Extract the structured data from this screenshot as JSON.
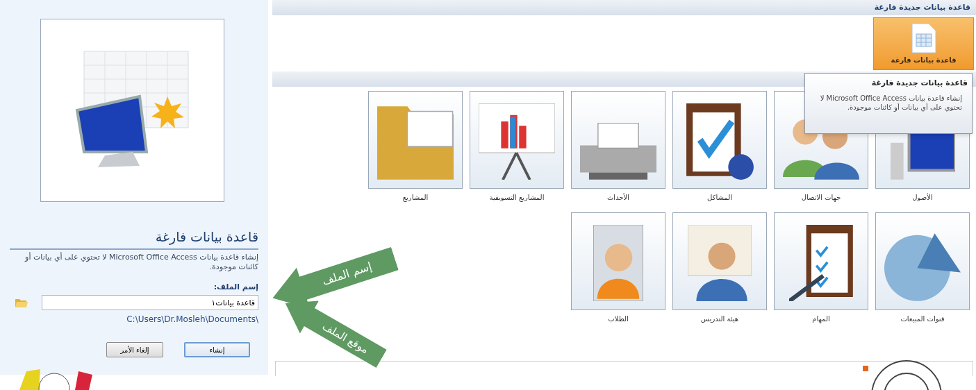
{
  "left_panel": {
    "title": "قاعدة بيانات فارغة",
    "description": "إنشاء قاعدة بيانات Microsoft Office Access لا تحتوي على أي بيانات أو كائنات موجودة.",
    "file_name_label": "إسم الملف:",
    "file_name": "قاعدة بيانات١",
    "path": "C:\\Users\\Dr.Mosleh\\Documents\\",
    "buttons": [
      {
        "label": "إنشاء",
        "default": true
      },
      {
        "label": "إلغاء الأمر",
        "default": false
      }
    ]
  },
  "new_blank_section": {
    "header": "قاعدة بيانات جديدة فارغة",
    "tile_label": "قاعدة بيانات فارغة"
  },
  "tooltip": {
    "title": "قاعدة بيانات جديدة فارغة",
    "text": "إنشاء قاعدة بيانات Microsoft Office Access لا تحتوي على أي بيانات أو كائنات موجودة."
  },
  "template_rows": [
    {
      "items": [
        {
          "label": "الأصول",
          "kind": "computer"
        },
        {
          "label": "جهات الاتصال",
          "kind": "people"
        },
        {
          "label": "المشاكل",
          "kind": "clipboard"
        },
        {
          "label": "الأحداث",
          "kind": "fax"
        },
        {
          "label": "المشاريع التسويقية",
          "kind": "chart"
        },
        {
          "label": "المشاريع",
          "kind": "folder"
        }
      ]
    },
    {
      "items": [
        {
          "label": "قنوات المبيعات",
          "kind": "pie"
        },
        {
          "label": "المهام",
          "kind": "checklist"
        },
        {
          "label": "هيئة التدريس",
          "kind": "teacher"
        },
        {
          "label": "الطلاب",
          "kind": "student"
        }
      ]
    }
  ],
  "annotations": [
    {
      "text": "إسم الملف"
    },
    {
      "text": "موقع الملف"
    }
  ]
}
